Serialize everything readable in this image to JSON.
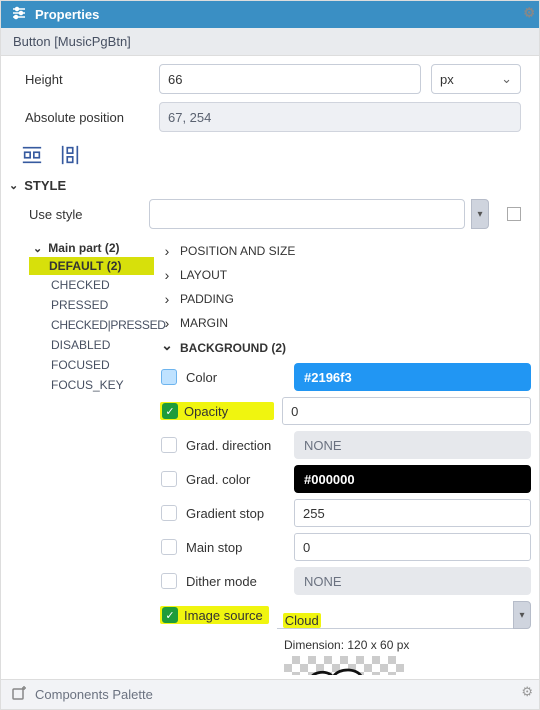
{
  "panel": {
    "title": "Properties"
  },
  "object_bar": "Button [MusicPgBtn]",
  "height": {
    "label": "Height",
    "value": "66",
    "unit": "px"
  },
  "position": {
    "label": "Absolute position",
    "value": "67, 254"
  },
  "style_section": {
    "label": "STYLE"
  },
  "use_style": {
    "label": "Use style",
    "value": ""
  },
  "tree": {
    "main_part": "Main part (2)",
    "default": "DEFAULT (2)",
    "states": [
      "CHECKED",
      "PRESSED",
      "CHECKED|PRESSED",
      "DISABLED",
      "FOCUSED",
      "FOCUS_KEY"
    ]
  },
  "groups": {
    "position_and_size": "POSITION AND SIZE",
    "layout": "LAYOUT",
    "padding": "PADDING",
    "margin": "MARGIN",
    "background": "BACKGROUND (2)"
  },
  "bg": {
    "color": {
      "label": "Color",
      "value": "#2196f3"
    },
    "opacity": {
      "label": "Opacity",
      "value": "0"
    },
    "grad_direction": {
      "label": "Grad. direction",
      "value": "NONE"
    },
    "grad_color": {
      "label": "Grad. color",
      "value": "#000000"
    },
    "gradient_stop": {
      "label": "Gradient stop",
      "value": "255"
    },
    "main_stop": {
      "label": "Main stop",
      "value": "0"
    },
    "dither_mode": {
      "label": "Dither mode",
      "value": "NONE"
    },
    "image_source": {
      "label": "Image source",
      "value": "Cloud"
    },
    "dimension": "Dimension: 120 x 60 px"
  },
  "footer": {
    "label": "Components Palette"
  }
}
